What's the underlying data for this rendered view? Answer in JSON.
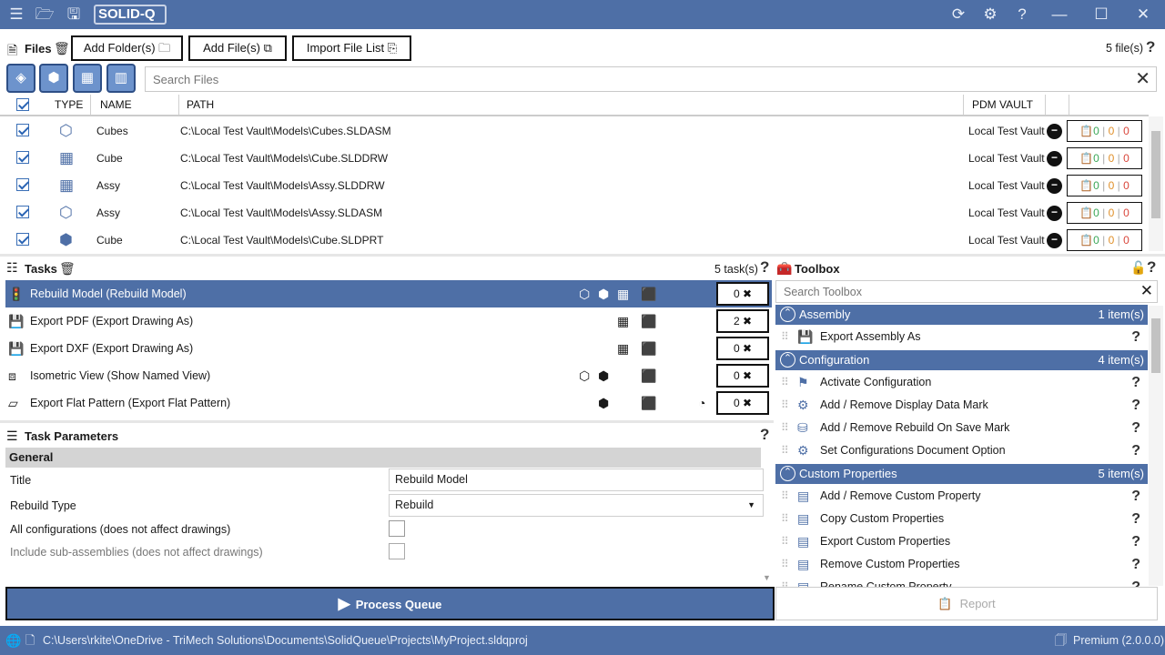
{
  "app": {
    "logo": "SOLID-Q"
  },
  "files": {
    "title": "Files",
    "add_folders": "Add Folder(s)",
    "add_files": "Add File(s)",
    "import_list": "Import File List",
    "count": "5 file(s)",
    "search_placeholder": "Search Files",
    "columns": {
      "type": "TYPE",
      "name": "NAME",
      "path": "PATH",
      "vault": "PDM VAULT"
    },
    "rows": [
      {
        "name": "Cubes",
        "path": "C:\\Local Test Vault\\Models\\Cubes.SLDASM",
        "vault": "Local Test Vault",
        "b1": "0",
        "b2": "0",
        "b3": "0",
        "icon": "assembly-icon"
      },
      {
        "name": "Cube",
        "path": "C:\\Local Test Vault\\Models\\Cube.SLDDRW",
        "vault": "Local Test Vault",
        "b1": "0",
        "b2": "0",
        "b3": "0",
        "icon": "drawing-icon"
      },
      {
        "name": "Assy",
        "path": "C:\\Local Test Vault\\Models\\Assy.SLDDRW",
        "vault": "Local Test Vault",
        "b1": "0",
        "b2": "0",
        "b3": "0",
        "icon": "drawing-icon"
      },
      {
        "name": "Assy",
        "path": "C:\\Local Test Vault\\Models\\Assy.SLDASM",
        "vault": "Local Test Vault",
        "b1": "0",
        "b2": "0",
        "b3": "0",
        "icon": "assembly-icon"
      },
      {
        "name": "Cube",
        "path": "C:\\Local Test Vault\\Models\\Cube.SLDPRT",
        "vault": "Local Test Vault",
        "b1": "0",
        "b2": "0",
        "b3": "0",
        "icon": "part-icon"
      }
    ]
  },
  "tasks": {
    "title": "Tasks",
    "count": "5 task(s)",
    "items": [
      {
        "label": "Rebuild Model (Rebuild Model)",
        "count": "0",
        "selected": true,
        "icon": "rebuild-icon"
      },
      {
        "label": "Export PDF (Export Drawing As)",
        "count": "2",
        "selected": false,
        "icon": "save-icon"
      },
      {
        "label": "Export DXF (Export Drawing As)",
        "count": "0",
        "selected": false,
        "icon": "save-icon"
      },
      {
        "label": "Isometric View (Show Named View)",
        "count": "0",
        "selected": false,
        "icon": "cube-view-icon"
      },
      {
        "label": "Export Flat Pattern (Export Flat Pattern)",
        "count": "0",
        "selected": false,
        "icon": "flat-pattern-icon"
      }
    ]
  },
  "params": {
    "title": "Task Parameters",
    "group": "General",
    "title_label": "Title",
    "title_value": "Rebuild Model",
    "rebuild_label": "Rebuild Type",
    "rebuild_value": "Rebuild",
    "allconf_label": "All configurations (does not affect drawings)",
    "subasm_label": "Include sub-assemblies (does not affect drawings)"
  },
  "toolbox": {
    "title": "Toolbox",
    "search_placeholder": "Search Toolbox",
    "groups": [
      {
        "name": "Assembly",
        "count": "1 item(s)",
        "items": [
          "Export Assembly As"
        ]
      },
      {
        "name": "Configuration",
        "count": "4 item(s)",
        "items": [
          "Activate Configuration",
          "Add / Remove Display Data Mark",
          "Add / Remove Rebuild On Save Mark",
          "Set Configurations Document Option"
        ]
      },
      {
        "name": "Custom Properties",
        "count": "5 item(s)",
        "items": [
          "Add / Remove Custom Property",
          "Copy Custom Properties",
          "Export Custom Properties",
          "Remove Custom Properties",
          "Rename Custom Property"
        ]
      }
    ]
  },
  "actions": {
    "process": "Process Queue",
    "report": "Report"
  },
  "status": {
    "path": "C:\\Users\\rkite\\OneDrive - TriMech Solutions\\Documents\\SolidQueue\\Projects\\MyProject.sldqproj",
    "license": "Premium (2.0.0.0)"
  },
  "colors": {
    "accent": "#4e6fa6",
    "green": "#3aa757",
    "orange": "#e0902a",
    "red": "#d9453a"
  }
}
